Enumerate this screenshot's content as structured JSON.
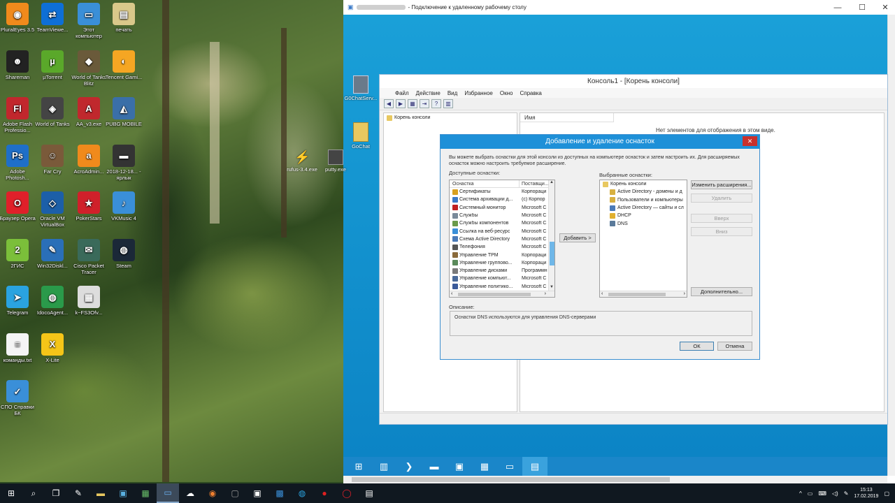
{
  "desktop": {
    "icons": [
      {
        "label": "PluralEyes 3.5",
        "color": "#f08a1c",
        "glyph": "◉"
      },
      {
        "label": "TeamViewe...",
        "color": "#0e6fd6",
        "glyph": "⇄"
      },
      {
        "label": "Этот компьютер",
        "color": "#3a8fd8",
        "glyph": "▭"
      },
      {
        "label": "печать",
        "color": "#d9c88a",
        "glyph": "▤"
      },
      {
        "label": "Shareman",
        "color": "#222222",
        "glyph": "☻"
      },
      {
        "label": "µTorrent",
        "color": "#5aa82a",
        "glyph": "µ"
      },
      {
        "label": "World of Tanks Blitz",
        "color": "#6a5a3a",
        "glyph": "◆"
      },
      {
        "label": "Tencent Gami...",
        "color": "#f5a623",
        "glyph": "◐"
      },
      {
        "label": "Adobe Flash Professio...",
        "color": "#c1272d",
        "glyph": "Fl"
      },
      {
        "label": "World of Tanks",
        "color": "#444444",
        "glyph": "◈"
      },
      {
        "label": "AA_v3.exe",
        "color": "#c0282d",
        "glyph": "A"
      },
      {
        "label": "PUBG MOBILE",
        "color": "#3a6fa8",
        "glyph": "◭"
      },
      {
        "label": "Adobe Photosh...",
        "color": "#1f6fc8",
        "glyph": "Ps"
      },
      {
        "label": "Far Cry",
        "color": "#7a5a3a",
        "glyph": "☺"
      },
      {
        "label": "AcroAdmin...",
        "color": "#f08a1c",
        "glyph": "a"
      },
      {
        "label": "2018-12-18... - ярлык",
        "color": "#333333",
        "glyph": "▬"
      },
      {
        "label": "Браузер Opera",
        "color": "#e0202a",
        "glyph": "O"
      },
      {
        "label": "Oracle VM VirtualBox",
        "color": "#1c5fa8",
        "glyph": "◇"
      },
      {
        "label": "PokerStars",
        "color": "#d0202a",
        "glyph": "★"
      },
      {
        "label": "VKMusic 4",
        "color": "#3a8fd8",
        "glyph": "♪"
      },
      {
        "label": "2ГИС",
        "color": "#7bbf3a",
        "glyph": "2"
      },
      {
        "label": "Win32Diskl...",
        "color": "#2a6fb8",
        "glyph": "✎"
      },
      {
        "label": "Cisco Packet Tracer",
        "color": "#3a6a5a",
        "glyph": "✉"
      },
      {
        "label": "Steam",
        "color": "#1b2838",
        "glyph": "◍"
      },
      {
        "label": "Telegram",
        "color": "#2aa3e0",
        "glyph": "➤"
      },
      {
        "label": "IdocoAgent...",
        "color": "#2a9a4a",
        "glyph": "◍"
      },
      {
        "label": "k~FS3Ofv...",
        "color": "#dddddd",
        "glyph": "▦"
      },
      {
        "label": "команды.txt",
        "color": "#f4f4f4",
        "glyph": "≡"
      },
      {
        "label": "X-Lite",
        "color": "#f5c518",
        "glyph": "X"
      },
      {
        "label": "СПО Справки БК",
        "color": "#3a8fd8",
        "glyph": "✓"
      }
    ]
  },
  "rdp": {
    "title_suffix": "- Подключение к удаленному рабочему столу",
    "controls": {
      "minimize": "—",
      "maximize": "☐",
      "close": "✕"
    },
    "remote_icons": [
      {
        "label": "G0ChatServ..."
      },
      {
        "label": "GoChat"
      },
      {
        "label": "rufus-3.4.exe"
      },
      {
        "label": "putty.exe"
      }
    ]
  },
  "mmc": {
    "title": "Консоль1 - [Корень консоли]",
    "menu": [
      "Файл",
      "Действие",
      "Вид",
      "Избранное",
      "Окно",
      "Справка"
    ],
    "tree_root": "Корень консоли",
    "column_name": "Имя",
    "empty_message": "Нет элементов для отображения в этом виде."
  },
  "dialog": {
    "title": "Добавление и удаление оснасток",
    "close": "✕",
    "intro": "Вы можете выбрать оснастки для этой консоли из доступных на компьютере оснасток и затем настроить их. Для расширяемых оснасток можно настроить требуемое расширение.",
    "available_label": "Доступные оснастки:",
    "selected_label": "Выбранные оснастки:",
    "columns": {
      "name": "Оснастка",
      "publisher": "Поставщи..."
    },
    "available": [
      {
        "name": "Сертификаты",
        "publisher": "Корпораци",
        "color": "#d8a020"
      },
      {
        "name": "Система архивации д...",
        "publisher": "(с) Корпор",
        "color": "#3a7ac8"
      },
      {
        "name": "Системный монитор",
        "publisher": "Microsoft C",
        "color": "#c02020"
      },
      {
        "name": "Службы",
        "publisher": "Microsoft C",
        "color": "#7a8a9a"
      },
      {
        "name": "Службы компонентов",
        "publisher": "Microsoft C",
        "color": "#6a9a4a"
      },
      {
        "name": "Ссылка на веб-ресурс",
        "publisher": "Microsoft C",
        "color": "#3a8fd8"
      },
      {
        "name": "Схема Active Directory",
        "publisher": "Microsoft C",
        "color": "#4a7ab8"
      },
      {
        "name": "Телефония",
        "publisher": "Microsoft C",
        "color": "#555555"
      },
      {
        "name": "Управление TPM",
        "publisher": "Корпораци",
        "color": "#8a6a3a"
      },
      {
        "name": "Управление группово...",
        "publisher": "Корпораци",
        "color": "#5a8a5a"
      },
      {
        "name": "Управление дисками",
        "publisher": "Программн",
        "color": "#7a7a7a"
      },
      {
        "name": "Управление компьют...",
        "publisher": "Microsoft C",
        "color": "#4a6a9a"
      },
      {
        "name": "Управление политико...",
        "publisher": "Microsoft C",
        "color": "#3a5a9a"
      }
    ],
    "selected_root": "Корень консоли",
    "selected": [
      {
        "name": "Active Directory - домены и д",
        "color": "#d8b040"
      },
      {
        "name": "Пользователи и компьютеры",
        "color": "#d8b040"
      },
      {
        "name": "Active Directory — сайты и сл",
        "color": "#4a7ab8"
      },
      {
        "name": "DHCP",
        "color": "#e0b030"
      },
      {
        "name": "DNS",
        "color": "#5a7a9a"
      }
    ],
    "add_button": "Добавить >",
    "buttons": {
      "extensions": "Изменить расширения...",
      "remove": "Удалить",
      "up": "Вверх",
      "down": "Вниз",
      "advanced": "Дополнительно..."
    },
    "description_label": "Описание:",
    "description": "Оснастки DNS используются для управления DNS-серверами",
    "ok": "ОК",
    "cancel": "Отмена"
  },
  "taskbar": {
    "time": "15:13",
    "date": "17.02.2019",
    "tray_chevron": "^",
    "colors": {
      "bg": "#101820",
      "server_bg": "#1a86c9"
    }
  }
}
